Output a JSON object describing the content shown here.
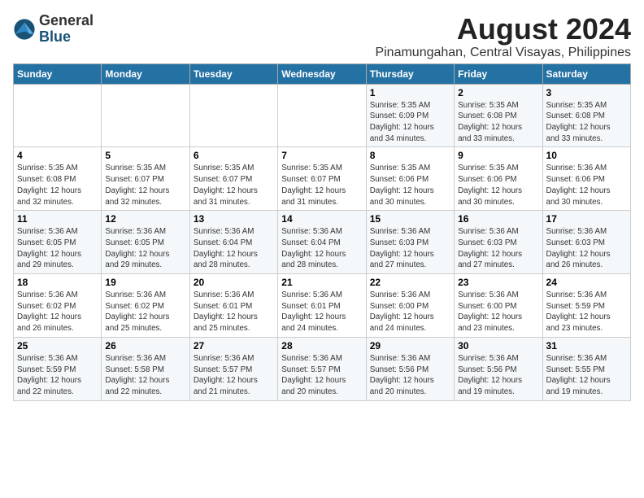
{
  "header": {
    "logo_line1": "General",
    "logo_line2": "Blue",
    "title": "August 2024",
    "subtitle": "Pinamungahan, Central Visayas, Philippines"
  },
  "days_of_week": [
    "Sunday",
    "Monday",
    "Tuesday",
    "Wednesday",
    "Thursday",
    "Friday",
    "Saturday"
  ],
  "weeks": [
    [
      {
        "day": "",
        "info": ""
      },
      {
        "day": "",
        "info": ""
      },
      {
        "day": "",
        "info": ""
      },
      {
        "day": "",
        "info": ""
      },
      {
        "day": "1",
        "info": "Sunrise: 5:35 AM\nSunset: 6:09 PM\nDaylight: 12 hours\nand 34 minutes."
      },
      {
        "day": "2",
        "info": "Sunrise: 5:35 AM\nSunset: 6:08 PM\nDaylight: 12 hours\nand 33 minutes."
      },
      {
        "day": "3",
        "info": "Sunrise: 5:35 AM\nSunset: 6:08 PM\nDaylight: 12 hours\nand 33 minutes."
      }
    ],
    [
      {
        "day": "4",
        "info": "Sunrise: 5:35 AM\nSunset: 6:08 PM\nDaylight: 12 hours\nand 32 minutes."
      },
      {
        "day": "5",
        "info": "Sunrise: 5:35 AM\nSunset: 6:07 PM\nDaylight: 12 hours\nand 32 minutes."
      },
      {
        "day": "6",
        "info": "Sunrise: 5:35 AM\nSunset: 6:07 PM\nDaylight: 12 hours\nand 31 minutes."
      },
      {
        "day": "7",
        "info": "Sunrise: 5:35 AM\nSunset: 6:07 PM\nDaylight: 12 hours\nand 31 minutes."
      },
      {
        "day": "8",
        "info": "Sunrise: 5:35 AM\nSunset: 6:06 PM\nDaylight: 12 hours\nand 30 minutes."
      },
      {
        "day": "9",
        "info": "Sunrise: 5:35 AM\nSunset: 6:06 PM\nDaylight: 12 hours\nand 30 minutes."
      },
      {
        "day": "10",
        "info": "Sunrise: 5:36 AM\nSunset: 6:06 PM\nDaylight: 12 hours\nand 30 minutes."
      }
    ],
    [
      {
        "day": "11",
        "info": "Sunrise: 5:36 AM\nSunset: 6:05 PM\nDaylight: 12 hours\nand 29 minutes."
      },
      {
        "day": "12",
        "info": "Sunrise: 5:36 AM\nSunset: 6:05 PM\nDaylight: 12 hours\nand 29 minutes."
      },
      {
        "day": "13",
        "info": "Sunrise: 5:36 AM\nSunset: 6:04 PM\nDaylight: 12 hours\nand 28 minutes."
      },
      {
        "day": "14",
        "info": "Sunrise: 5:36 AM\nSunset: 6:04 PM\nDaylight: 12 hours\nand 28 minutes."
      },
      {
        "day": "15",
        "info": "Sunrise: 5:36 AM\nSunset: 6:03 PM\nDaylight: 12 hours\nand 27 minutes."
      },
      {
        "day": "16",
        "info": "Sunrise: 5:36 AM\nSunset: 6:03 PM\nDaylight: 12 hours\nand 27 minutes."
      },
      {
        "day": "17",
        "info": "Sunrise: 5:36 AM\nSunset: 6:03 PM\nDaylight: 12 hours\nand 26 minutes."
      }
    ],
    [
      {
        "day": "18",
        "info": "Sunrise: 5:36 AM\nSunset: 6:02 PM\nDaylight: 12 hours\nand 26 minutes."
      },
      {
        "day": "19",
        "info": "Sunrise: 5:36 AM\nSunset: 6:02 PM\nDaylight: 12 hours\nand 25 minutes."
      },
      {
        "day": "20",
        "info": "Sunrise: 5:36 AM\nSunset: 6:01 PM\nDaylight: 12 hours\nand 25 minutes."
      },
      {
        "day": "21",
        "info": "Sunrise: 5:36 AM\nSunset: 6:01 PM\nDaylight: 12 hours\nand 24 minutes."
      },
      {
        "day": "22",
        "info": "Sunrise: 5:36 AM\nSunset: 6:00 PM\nDaylight: 12 hours\nand 24 minutes."
      },
      {
        "day": "23",
        "info": "Sunrise: 5:36 AM\nSunset: 6:00 PM\nDaylight: 12 hours\nand 23 minutes."
      },
      {
        "day": "24",
        "info": "Sunrise: 5:36 AM\nSunset: 5:59 PM\nDaylight: 12 hours\nand 23 minutes."
      }
    ],
    [
      {
        "day": "25",
        "info": "Sunrise: 5:36 AM\nSunset: 5:59 PM\nDaylight: 12 hours\nand 22 minutes."
      },
      {
        "day": "26",
        "info": "Sunrise: 5:36 AM\nSunset: 5:58 PM\nDaylight: 12 hours\nand 22 minutes."
      },
      {
        "day": "27",
        "info": "Sunrise: 5:36 AM\nSunset: 5:57 PM\nDaylight: 12 hours\nand 21 minutes."
      },
      {
        "day": "28",
        "info": "Sunrise: 5:36 AM\nSunset: 5:57 PM\nDaylight: 12 hours\nand 20 minutes."
      },
      {
        "day": "29",
        "info": "Sunrise: 5:36 AM\nSunset: 5:56 PM\nDaylight: 12 hours\nand 20 minutes."
      },
      {
        "day": "30",
        "info": "Sunrise: 5:36 AM\nSunset: 5:56 PM\nDaylight: 12 hours\nand 19 minutes."
      },
      {
        "day": "31",
        "info": "Sunrise: 5:36 AM\nSunset: 5:55 PM\nDaylight: 12 hours\nand 19 minutes."
      }
    ]
  ]
}
